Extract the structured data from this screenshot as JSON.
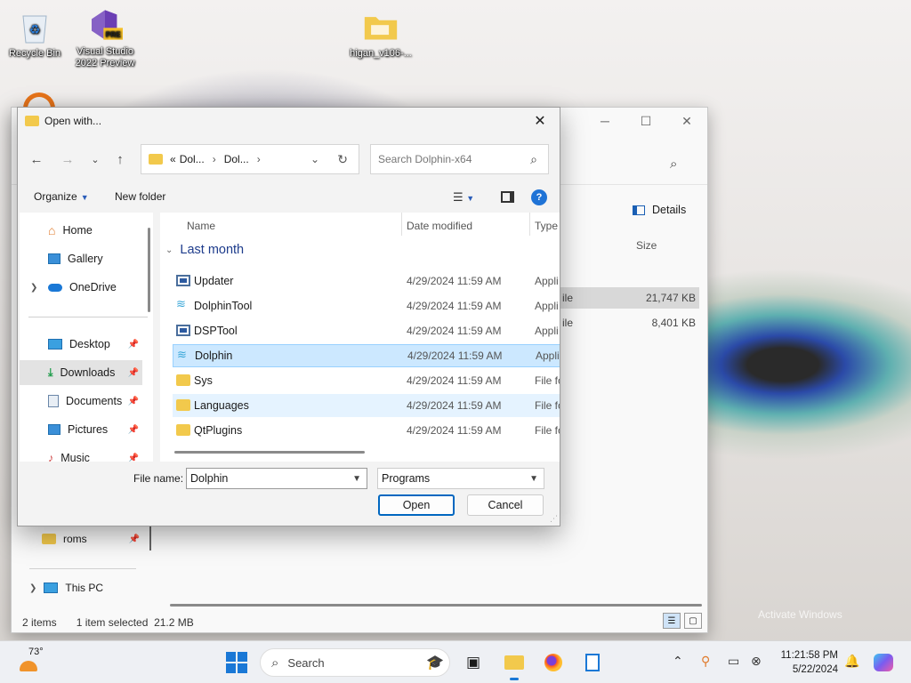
{
  "desktop": {
    "icons": [
      {
        "label": "Recycle Bin"
      },
      {
        "label": "Visual Studio 2022 Preview"
      },
      {
        "label": "higan_v106-..."
      }
    ]
  },
  "background_window": {
    "details_label": "Details",
    "size_header": "Size",
    "rows": [
      {
        "type": "ile",
        "size": "21,747 KB"
      },
      {
        "type": "ile",
        "size": "8,401 KB"
      }
    ],
    "nav": [
      {
        "label": "roms"
      },
      {
        "label": "This PC"
      }
    ],
    "status": {
      "items": "2 items",
      "selected": "1 item selected",
      "size": "21.2 MB"
    },
    "watermark": "Activate Windows"
  },
  "dialog": {
    "title": "Open with...",
    "address": {
      "prefix": "«",
      "crumbs": [
        "Dol...",
        "Dol..."
      ]
    },
    "search_placeholder": "Search Dolphin-x64",
    "commands": {
      "organize": "Organize",
      "new_folder": "New folder"
    },
    "nav_items": [
      {
        "label": "Home"
      },
      {
        "label": "Gallery"
      },
      {
        "label": "OneDrive"
      },
      {
        "label": "Desktop"
      },
      {
        "label": "Downloads"
      },
      {
        "label": "Documents"
      },
      {
        "label": "Pictures"
      },
      {
        "label": "Music"
      }
    ],
    "columns": {
      "name": "Name",
      "date": "Date modified",
      "type": "Type"
    },
    "group_label": "Last month",
    "files": [
      {
        "name": "Updater",
        "date": "4/29/2024 11:59 AM",
        "type": "Appli",
        "icon": "app"
      },
      {
        "name": "DolphinTool",
        "date": "4/29/2024 11:59 AM",
        "type": "Appli",
        "icon": "dolphin"
      },
      {
        "name": "DSPTool",
        "date": "4/29/2024 11:59 AM",
        "type": "Appli",
        "icon": "app"
      },
      {
        "name": "Dolphin",
        "date": "4/29/2024 11:59 AM",
        "type": "Appli",
        "icon": "dolphin"
      },
      {
        "name": "Sys",
        "date": "4/29/2024 11:59 AM",
        "type": "File fo",
        "icon": "folder"
      },
      {
        "name": "Languages",
        "date": "4/29/2024 11:59 AM",
        "type": "File fo",
        "icon": "folder"
      },
      {
        "name": "QtPlugins",
        "date": "4/29/2024 11:59 AM",
        "type": "File fo",
        "icon": "folder"
      }
    ],
    "file_name_label": "File name:",
    "file_name_value": "Dolphin",
    "file_type_value": "Programs",
    "open_label": "Open",
    "cancel_label": "Cancel"
  },
  "taskbar": {
    "weather_temp": "73°",
    "search_label": "Search",
    "time": "11:21:58 PM",
    "date": "5/22/2024"
  },
  "colors": {
    "accent": "#0067c0",
    "selection": "#cce8ff",
    "folder": "#f2c94c",
    "group_text": "#1e3c8c"
  }
}
